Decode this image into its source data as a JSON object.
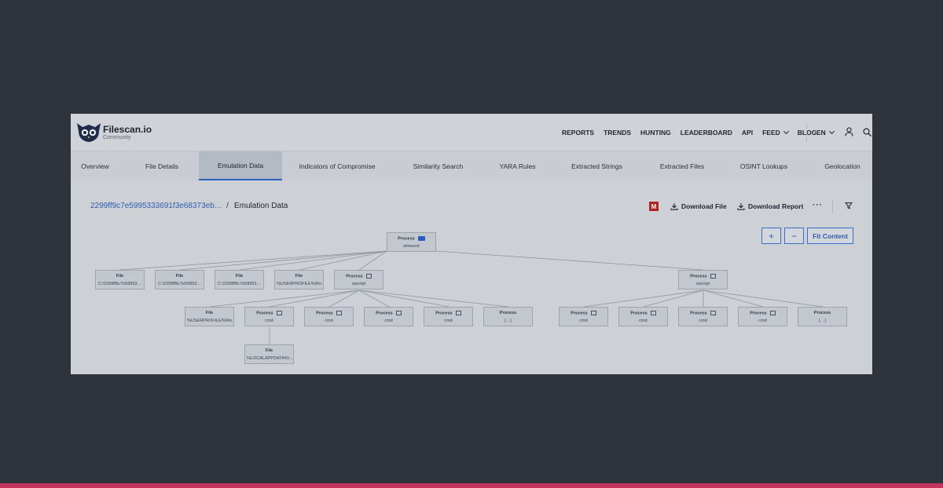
{
  "brand": {
    "name": "Filescan.io",
    "subtitle": "Community"
  },
  "nav": {
    "items": [
      "REPORTS",
      "TRENDS",
      "HUNTING",
      "LEADERBOARD",
      "API",
      "FEED",
      "BLOG"
    ],
    "language": "EN"
  },
  "tabs": [
    {
      "label": "Overview",
      "active": false
    },
    {
      "label": "File Details",
      "active": false
    },
    {
      "label": "Emulation Data",
      "active": true
    },
    {
      "label": "Indicators of Compromise",
      "active": false
    },
    {
      "label": "Similarity Search",
      "active": false
    },
    {
      "label": "YARA Rules",
      "active": false
    },
    {
      "label": "Extracted Strings",
      "active": false
    },
    {
      "label": "Extracted Files",
      "active": false
    },
    {
      "label": "OSINT Lookups",
      "active": false
    },
    {
      "label": "Geolocation",
      "active": false
    }
  ],
  "breadcrumb": {
    "hash": "2299ff9c7e5995333691f3e68373eb…",
    "separator": "/",
    "current": "Emulation Data"
  },
  "actions": {
    "badge": "M",
    "download_file": "Download File",
    "download_report": "Download Report",
    "more": "···"
  },
  "zoom": {
    "plus": "+",
    "minus": "−",
    "fit": "Fit Content"
  },
  "graph": {
    "root": {
      "type": "Process",
      "label": "winword",
      "icon": "word-icon"
    },
    "nodes": [
      {
        "type": "File",
        "label": "C:\\2299ff9c7e59953…"
      },
      {
        "type": "File",
        "label": "C:\\2299ff9c7e59953…"
      },
      {
        "type": "File",
        "label": "C:\\2299ff9c7e59953…"
      },
      {
        "type": "File",
        "label": "%USERPROFILE%\\Ro…"
      },
      {
        "type": "Process",
        "label": "wscript"
      },
      {
        "type": "Process",
        "label": "wscript"
      },
      {
        "type": "File",
        "label": "%USERPROFILE%\\Ro…"
      },
      {
        "type": "Process",
        "label": "cmd"
      },
      {
        "type": "Process",
        "label": "cmd"
      },
      {
        "type": "Process",
        "label": "cmd"
      },
      {
        "type": "Process",
        "label": "cmd"
      },
      {
        "type": "Process",
        "label": "(…)"
      },
      {
        "type": "File",
        "label": "%LOCALAPPDATA%\\…"
      },
      {
        "type": "Process",
        "label": "cmd"
      },
      {
        "type": "Process",
        "label": "cmd"
      },
      {
        "type": "Process",
        "label": "cmd"
      },
      {
        "type": "Process",
        "label": "cmd"
      },
      {
        "type": "Process",
        "label": "(…)"
      }
    ]
  },
  "colors": {
    "accent": "#2f63c2",
    "stripe": "#c6335a",
    "badge": "#b52121"
  }
}
